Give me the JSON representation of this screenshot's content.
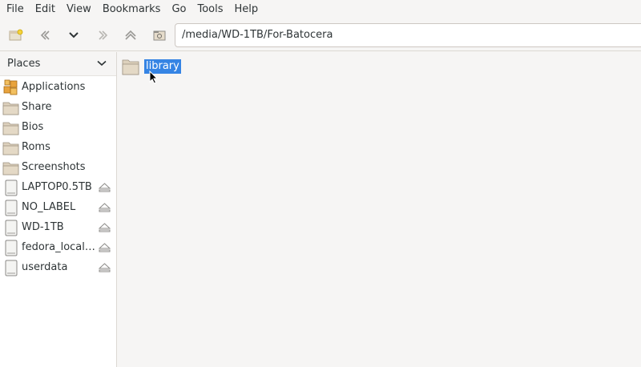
{
  "menubar": {
    "items": [
      "File",
      "Edit",
      "View",
      "Bookmarks",
      "Go",
      "Tools",
      "Help"
    ]
  },
  "toolbar": {
    "buttons": [
      "new-window-icon",
      "back-icon",
      "history-dropdown-icon",
      "forward-icon",
      "up-icon",
      "home-icon"
    ],
    "path": "/media/WD-1TB/For-Batocera"
  },
  "sidebar": {
    "header": "Places",
    "items": [
      {
        "label": "Applications",
        "icon": "applications-icon",
        "eject": false
      },
      {
        "label": "Share",
        "icon": "folder-icon",
        "eject": false
      },
      {
        "label": "Bios",
        "icon": "folder-icon",
        "eject": false
      },
      {
        "label": "Roms",
        "icon": "folder-icon",
        "eject": false
      },
      {
        "label": "Screenshots",
        "icon": "folder-icon",
        "eject": false
      },
      {
        "label": "LAPTOP0.5TB",
        "icon": "drive-icon",
        "eject": true
      },
      {
        "label": "NO_LABEL",
        "icon": "drive-icon",
        "eject": true
      },
      {
        "label": "WD-1TB",
        "icon": "drive-icon",
        "eject": true
      },
      {
        "label": "fedora_localhost-live",
        "icon": "drive-icon",
        "eject": true
      },
      {
        "label": "userdata",
        "icon": "drive-icon",
        "eject": true
      }
    ]
  },
  "main": {
    "files": [
      {
        "name": "library",
        "icon": "folder-icon",
        "selected": true
      }
    ]
  },
  "colors": {
    "selection": "#3584e4",
    "folder": "#d8c9b1",
    "window_bg": "#f6f5f4"
  }
}
